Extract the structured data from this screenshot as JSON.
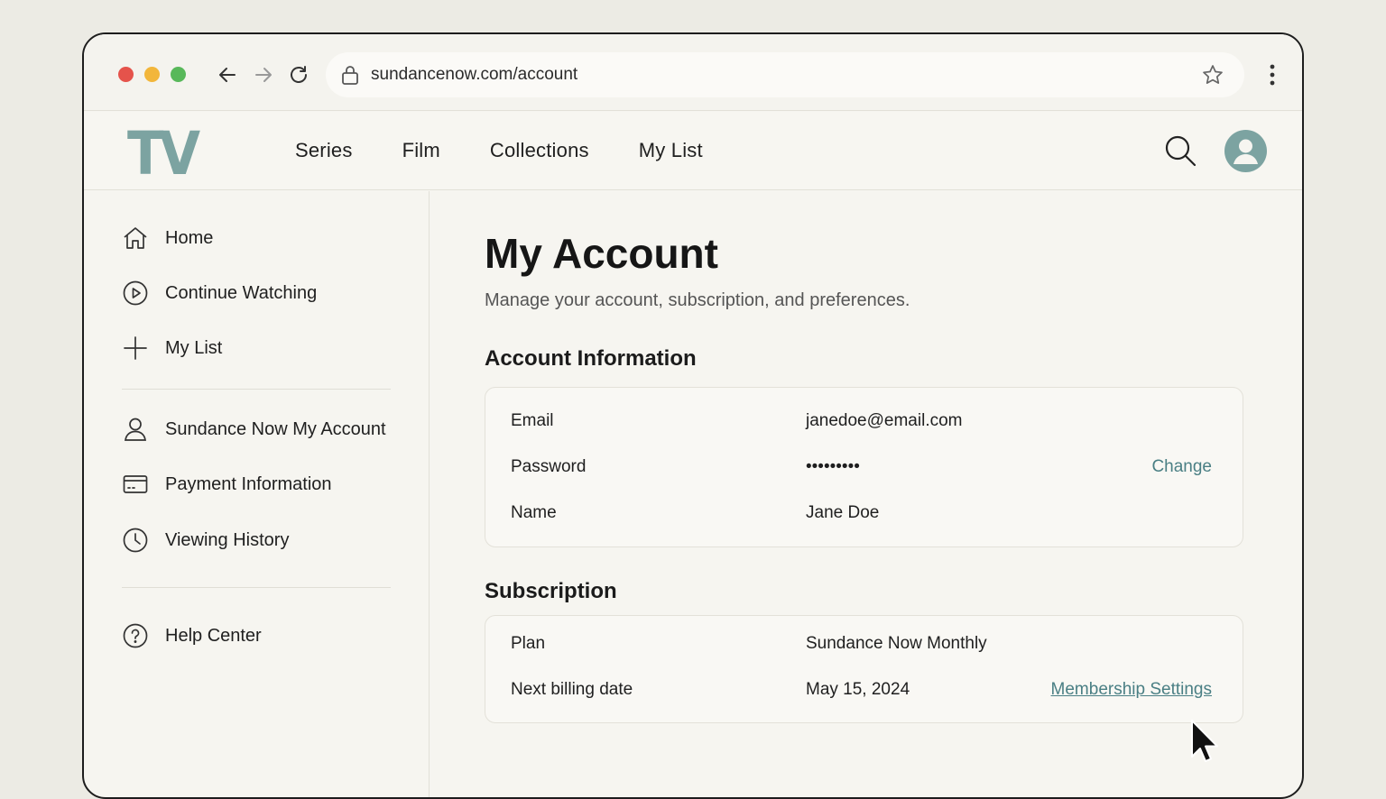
{
  "browser": {
    "url": "sundancenow.com/account"
  },
  "header": {
    "logo": "TV",
    "nav": [
      "Series",
      "Film",
      "Collections",
      "My List"
    ]
  },
  "sidebar": {
    "items": [
      {
        "label": "Home",
        "icon": "home-icon"
      },
      {
        "label": "Continue Watching",
        "icon": "play-circle-icon"
      },
      {
        "label": "My List",
        "icon": "plus-icon"
      },
      {
        "label": "Sundance Now My Account",
        "icon": "user-icon"
      },
      {
        "label": "Payment Information",
        "icon": "credit-card-icon"
      },
      {
        "label": "Viewing History",
        "icon": "clock-icon"
      },
      {
        "label": "Help Center",
        "icon": "help-icon"
      }
    ]
  },
  "main": {
    "title": "My Account",
    "subtitle": "Manage your account, subscription, and preferences.",
    "account": {
      "heading": "Account Information",
      "rows": [
        {
          "label": "Email",
          "value": "janedoe@email.com"
        },
        {
          "label": "Password",
          "value": "•••••••••",
          "action": "Change"
        },
        {
          "label": "Name",
          "value": "Jane Doe"
        }
      ]
    },
    "subscription": {
      "heading": "Subscription",
      "rows": [
        {
          "label": "Plan",
          "value": "Sundance Now Monthly"
        },
        {
          "label": "Next billing date",
          "value": "May 15, 2024",
          "action": "Membership Settings"
        }
      ]
    }
  },
  "colors": {
    "accent": "#7ca3a1",
    "link": "#4a7f84",
    "background": "#f6f5f0"
  }
}
